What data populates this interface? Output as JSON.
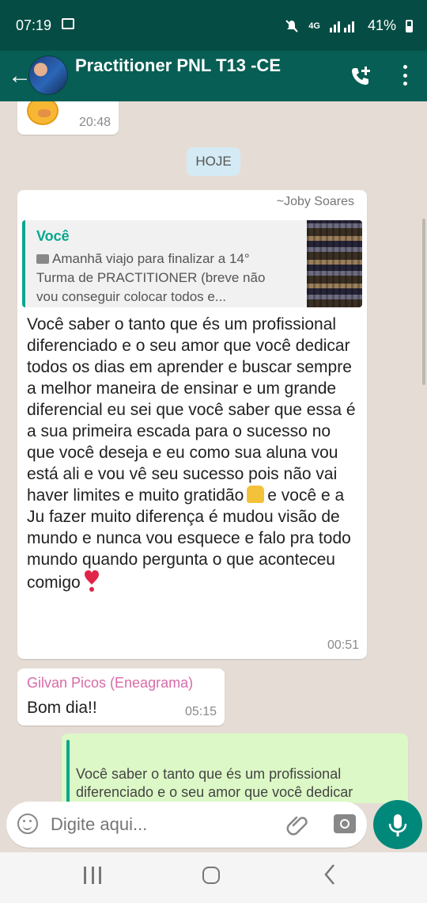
{
  "status_bar": {
    "time": "07:19",
    "network": "4G",
    "battery_pct": "41%",
    "icons": [
      "gallery-icon",
      "mute-icon",
      "signal-icon",
      "battery-icon"
    ]
  },
  "header": {
    "title": "Practitioner PNL T13 -CE",
    "icons": [
      "back-arrow-icon",
      "group-avatar",
      "add-call-icon",
      "more-options-icon"
    ]
  },
  "chat": {
    "previous_message": {
      "time": "20:48",
      "emoji": "face-hand-over-mouth"
    },
    "date_label": "HOJE",
    "message_joby": {
      "sender": "~Joby Soares",
      "quote": {
        "author": "Você",
        "text": "Amanhã viajo para finalizar a 14° Turma de PRACTITIONER (breve não vou conseguir colocar todos e..."
      },
      "text_part1": "Você saber o tanto que és um profissional diferenciado e o seu amor que você dedicar todos os dias em aprender e buscar sempre a melhor maneira de ensinar e um grande diferencial eu sei que você saber que essa é a sua primeira escada para o sucesso no que você deseja e eu como sua aluna vou está ali e vou vê seu sucesso pois não vai haver limites e muito gratidão",
      "text_part2": "e você e a Ju fazer muito diferença é mudou visão de mundo e nunca vou esquece e falo pra todo mundo quando pergunta o que aconteceu comigo",
      "time": "00:51"
    },
    "message_gilvan": {
      "sender": "Gilvan Picos (Eneagrama)",
      "text": "Bom dia!!",
      "time": "05:15"
    },
    "outgoing_message": {
      "text": "Você saber o tanto que és um profissional diferenciado e o seu amor que você dedicar"
    }
  },
  "composer": {
    "placeholder": "Digite aqui...",
    "icons": [
      "emoji-icon",
      "attach-icon",
      "camera-icon",
      "mic-icon"
    ]
  },
  "colors": {
    "header": "#075e54",
    "status_bar": "#054d44",
    "accent": "#00897b",
    "quote_bar": "#06a78e",
    "gilvan_name": "#d86ba8",
    "chat_bg": "#e5ddd5",
    "outgoing_bg": "#dcf8c6"
  }
}
